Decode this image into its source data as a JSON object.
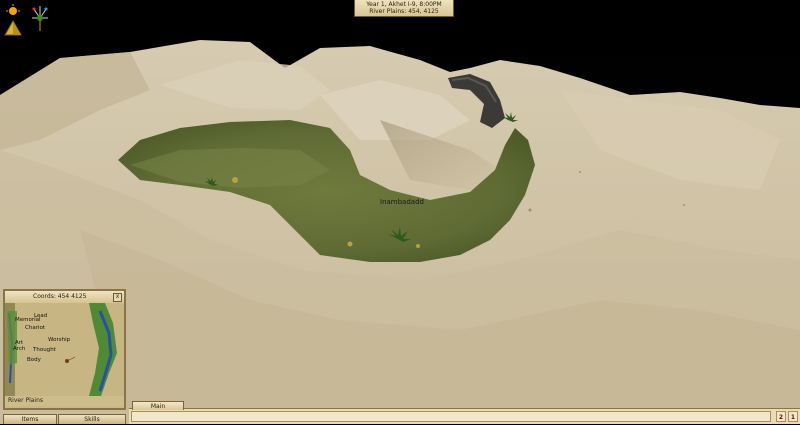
{
  "hud": {
    "date_line": "Year 1, Akhet I-9, 8:00PM",
    "location_line": "River Plains: 454, 4125"
  },
  "world": {
    "player_name": "Inambadadd"
  },
  "minimap": {
    "coords": "Coords: 454 4125",
    "close": "x",
    "region": "River Plains",
    "places": [
      {
        "label": "Memorial"
      },
      {
        "label": "Lead"
      },
      {
        "label": "Chariot"
      },
      {
        "label": "Worship"
      },
      {
        "label": "Art"
      },
      {
        "label": "Arch"
      },
      {
        "label": "Thought"
      },
      {
        "label": "Body"
      }
    ]
  },
  "tabs": {
    "items": "Items",
    "skills": "Skills"
  },
  "chat": {
    "tab_main": "Main",
    "btn_a": "2",
    "btn_b": "1"
  },
  "icons": {
    "pyramid": "pyramid-icon",
    "fireworks": "fireworks-icon"
  }
}
